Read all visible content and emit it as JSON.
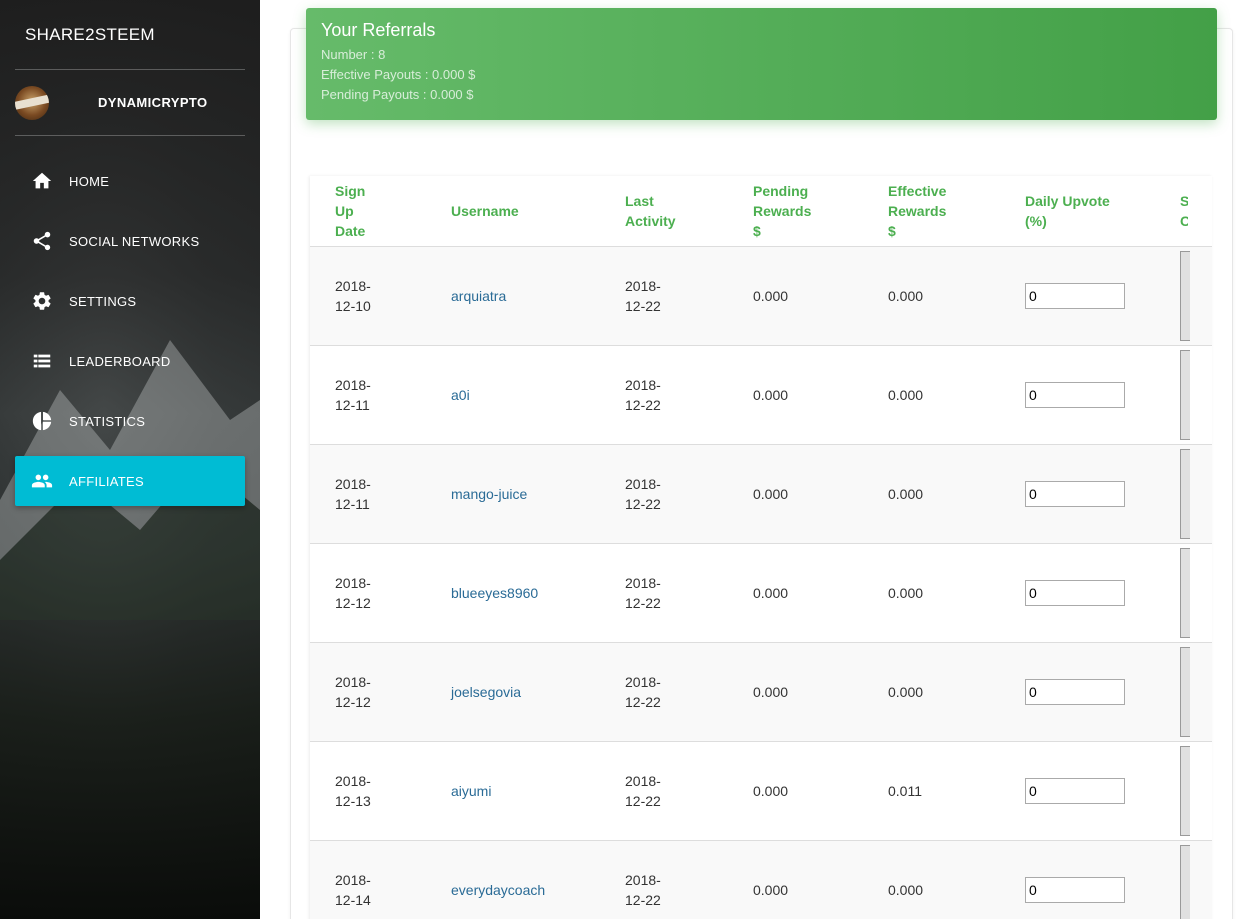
{
  "app": {
    "brand": "SHARE2STEEM",
    "username": "DYNAMICRYPTO"
  },
  "nav": [
    {
      "label": "HOME",
      "icon": "home-icon"
    },
    {
      "label": "SOCIAL NETWORKS",
      "icon": "share-icon"
    },
    {
      "label": "SETTINGS",
      "icon": "gear-icon"
    },
    {
      "label": "LEADERBOARD",
      "icon": "list-icon"
    },
    {
      "label": "STATISTICS",
      "icon": "pie-chart-icon"
    },
    {
      "label": "AFFILIATES",
      "icon": "people-icon",
      "active": true
    }
  ],
  "referrals": {
    "title": "Your Referrals",
    "number": "Number : 8",
    "effective": "Effective Payouts : 0.000 $",
    "pending": "Pending Payouts : 0.000 $"
  },
  "table": {
    "headers": [
      "Sign Up Date",
      "Username",
      "Last Activity",
      "Pending Rewards $",
      "Effective Rewards $",
      "Daily Upvote (%)",
      "S C"
    ],
    "rows": [
      {
        "signup": "2018-12-10",
        "username": "arquiatra",
        "last": "2018-12-22",
        "pending": "0.000",
        "effective": "0.000",
        "upvote": "0"
      },
      {
        "signup": "2018-12-11",
        "username": "a0i",
        "last": "2018-12-22",
        "pending": "0.000",
        "effective": "0.000",
        "upvote": "0"
      },
      {
        "signup": "2018-12-11",
        "username": "mango-juice",
        "last": "2018-12-22",
        "pending": "0.000",
        "effective": "0.000",
        "upvote": "0"
      },
      {
        "signup": "2018-12-12",
        "username": "blueeyes8960",
        "last": "2018-12-22",
        "pending": "0.000",
        "effective": "0.000",
        "upvote": "0"
      },
      {
        "signup": "2018-12-12",
        "username": "joelsegovia",
        "last": "2018-12-22",
        "pending": "0.000",
        "effective": "0.000",
        "upvote": "0"
      },
      {
        "signup": "2018-12-13",
        "username": "aiyumi",
        "last": "2018-12-22",
        "pending": "0.000",
        "effective": "0.011",
        "upvote": "0"
      },
      {
        "signup": "2018-12-14",
        "username": "everydaycoach",
        "last": "2018-12-22",
        "pending": "0.000",
        "effective": "0.000",
        "upvote": "0"
      }
    ]
  },
  "colors": {
    "accent": "#00bcd4",
    "green": "#4caf50",
    "link": "#2a6b96"
  }
}
